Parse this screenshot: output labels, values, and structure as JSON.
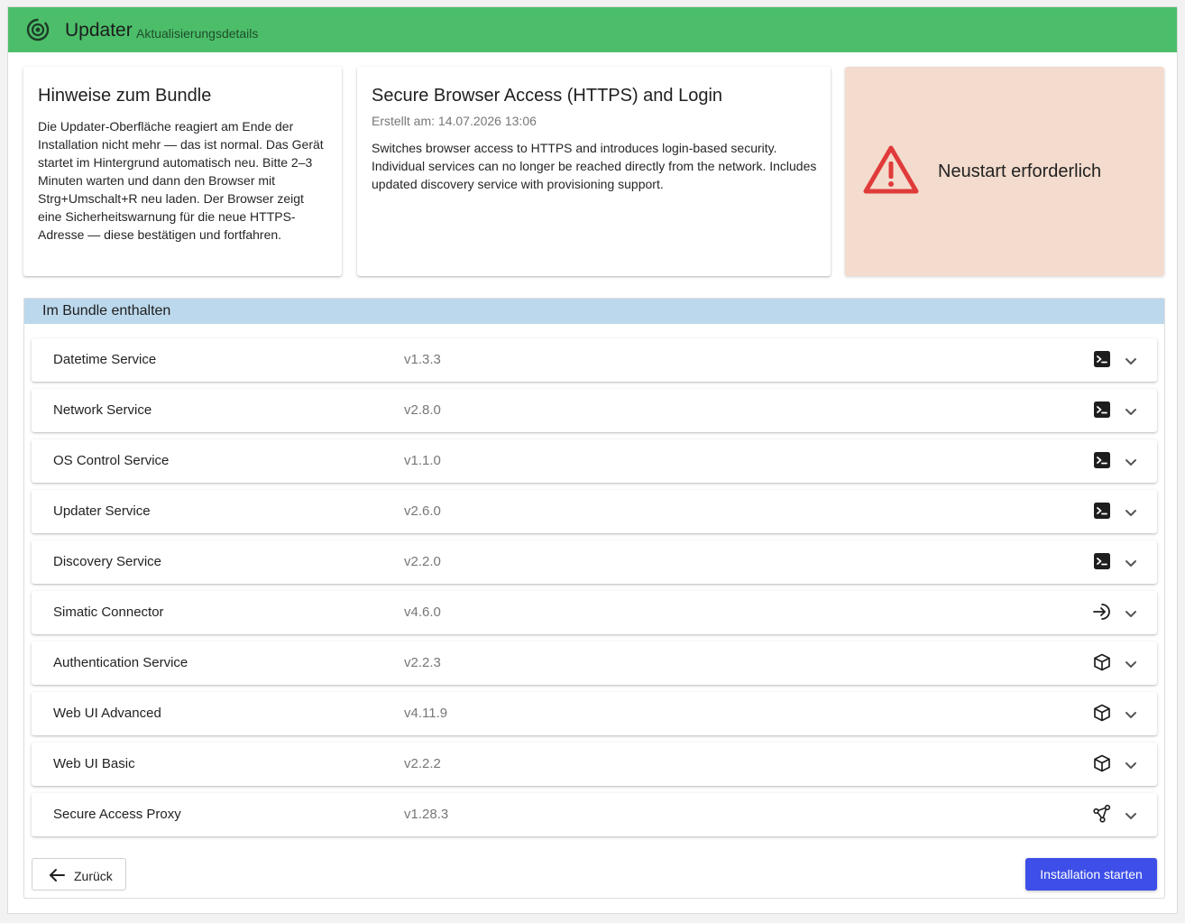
{
  "appbar": {
    "title": "Updater",
    "subtitle": "Aktualisierungsdetails",
    "logo_icon": "orbit-logo-icon",
    "color": "#4cbe6a"
  },
  "notes": {
    "title": "Hinweise zum Bundle",
    "text": "Die Updater-Oberfläche reagiert am Ende der Installation nicht mehr — das ist normal. Das Gerät startet im Hintergrund automatisch neu. Bitte 2–3 Minuten warten und dann den Browser mit Strg+Umschalt+R neu laden. Der Browser zeigt eine Sicherheitswarnung für die neue HTTPS-Adresse — diese bestätigen und fortfahren."
  },
  "bundle": {
    "title": "Secure Browser Access (HTTPS) and Login",
    "created": "Erstellt am: 14.07.2026 13:06",
    "description": "Switches browser access to HTTPS and introduces login-based security. Individual services can no longer be reached directly from the network. Includes updated discovery service with provisioning support."
  },
  "restart": {
    "text": "Neustart erforderlich",
    "icon": "warning-triangle-icon",
    "color": "#e03b3b",
    "background": "#f3dccd"
  },
  "included": {
    "header": "Im Bundle enthalten",
    "items": [
      {
        "name": "Datetime Service",
        "version": "v1.3.3",
        "icon": "terminal-icon"
      },
      {
        "name": "Network Service",
        "version": "v2.8.0",
        "icon": "terminal-icon"
      },
      {
        "name": "OS Control Service",
        "version": "v1.1.0",
        "icon": "terminal-icon"
      },
      {
        "name": "Updater Service",
        "version": "v2.6.0",
        "icon": "terminal-icon"
      },
      {
        "name": "Discovery Service",
        "version": "v2.2.0",
        "icon": "terminal-icon"
      },
      {
        "name": "Simatic Connector",
        "version": "v4.6.0",
        "icon": "login-arrow-icon"
      },
      {
        "name": "Authentication Service",
        "version": "v2.2.3",
        "icon": "cube-icon"
      },
      {
        "name": "Web UI Advanced",
        "version": "v4.11.9",
        "icon": "cube-icon"
      },
      {
        "name": "Web UI Basic",
        "version": "v2.2.2",
        "icon": "cube-icon"
      },
      {
        "name": "Secure Access Proxy",
        "version": "v1.28.3",
        "icon": "network-nodes-icon"
      }
    ]
  },
  "actions": {
    "back_label": "Zurück",
    "install_label": "Installation starten",
    "install_color": "#3d4fe8"
  }
}
